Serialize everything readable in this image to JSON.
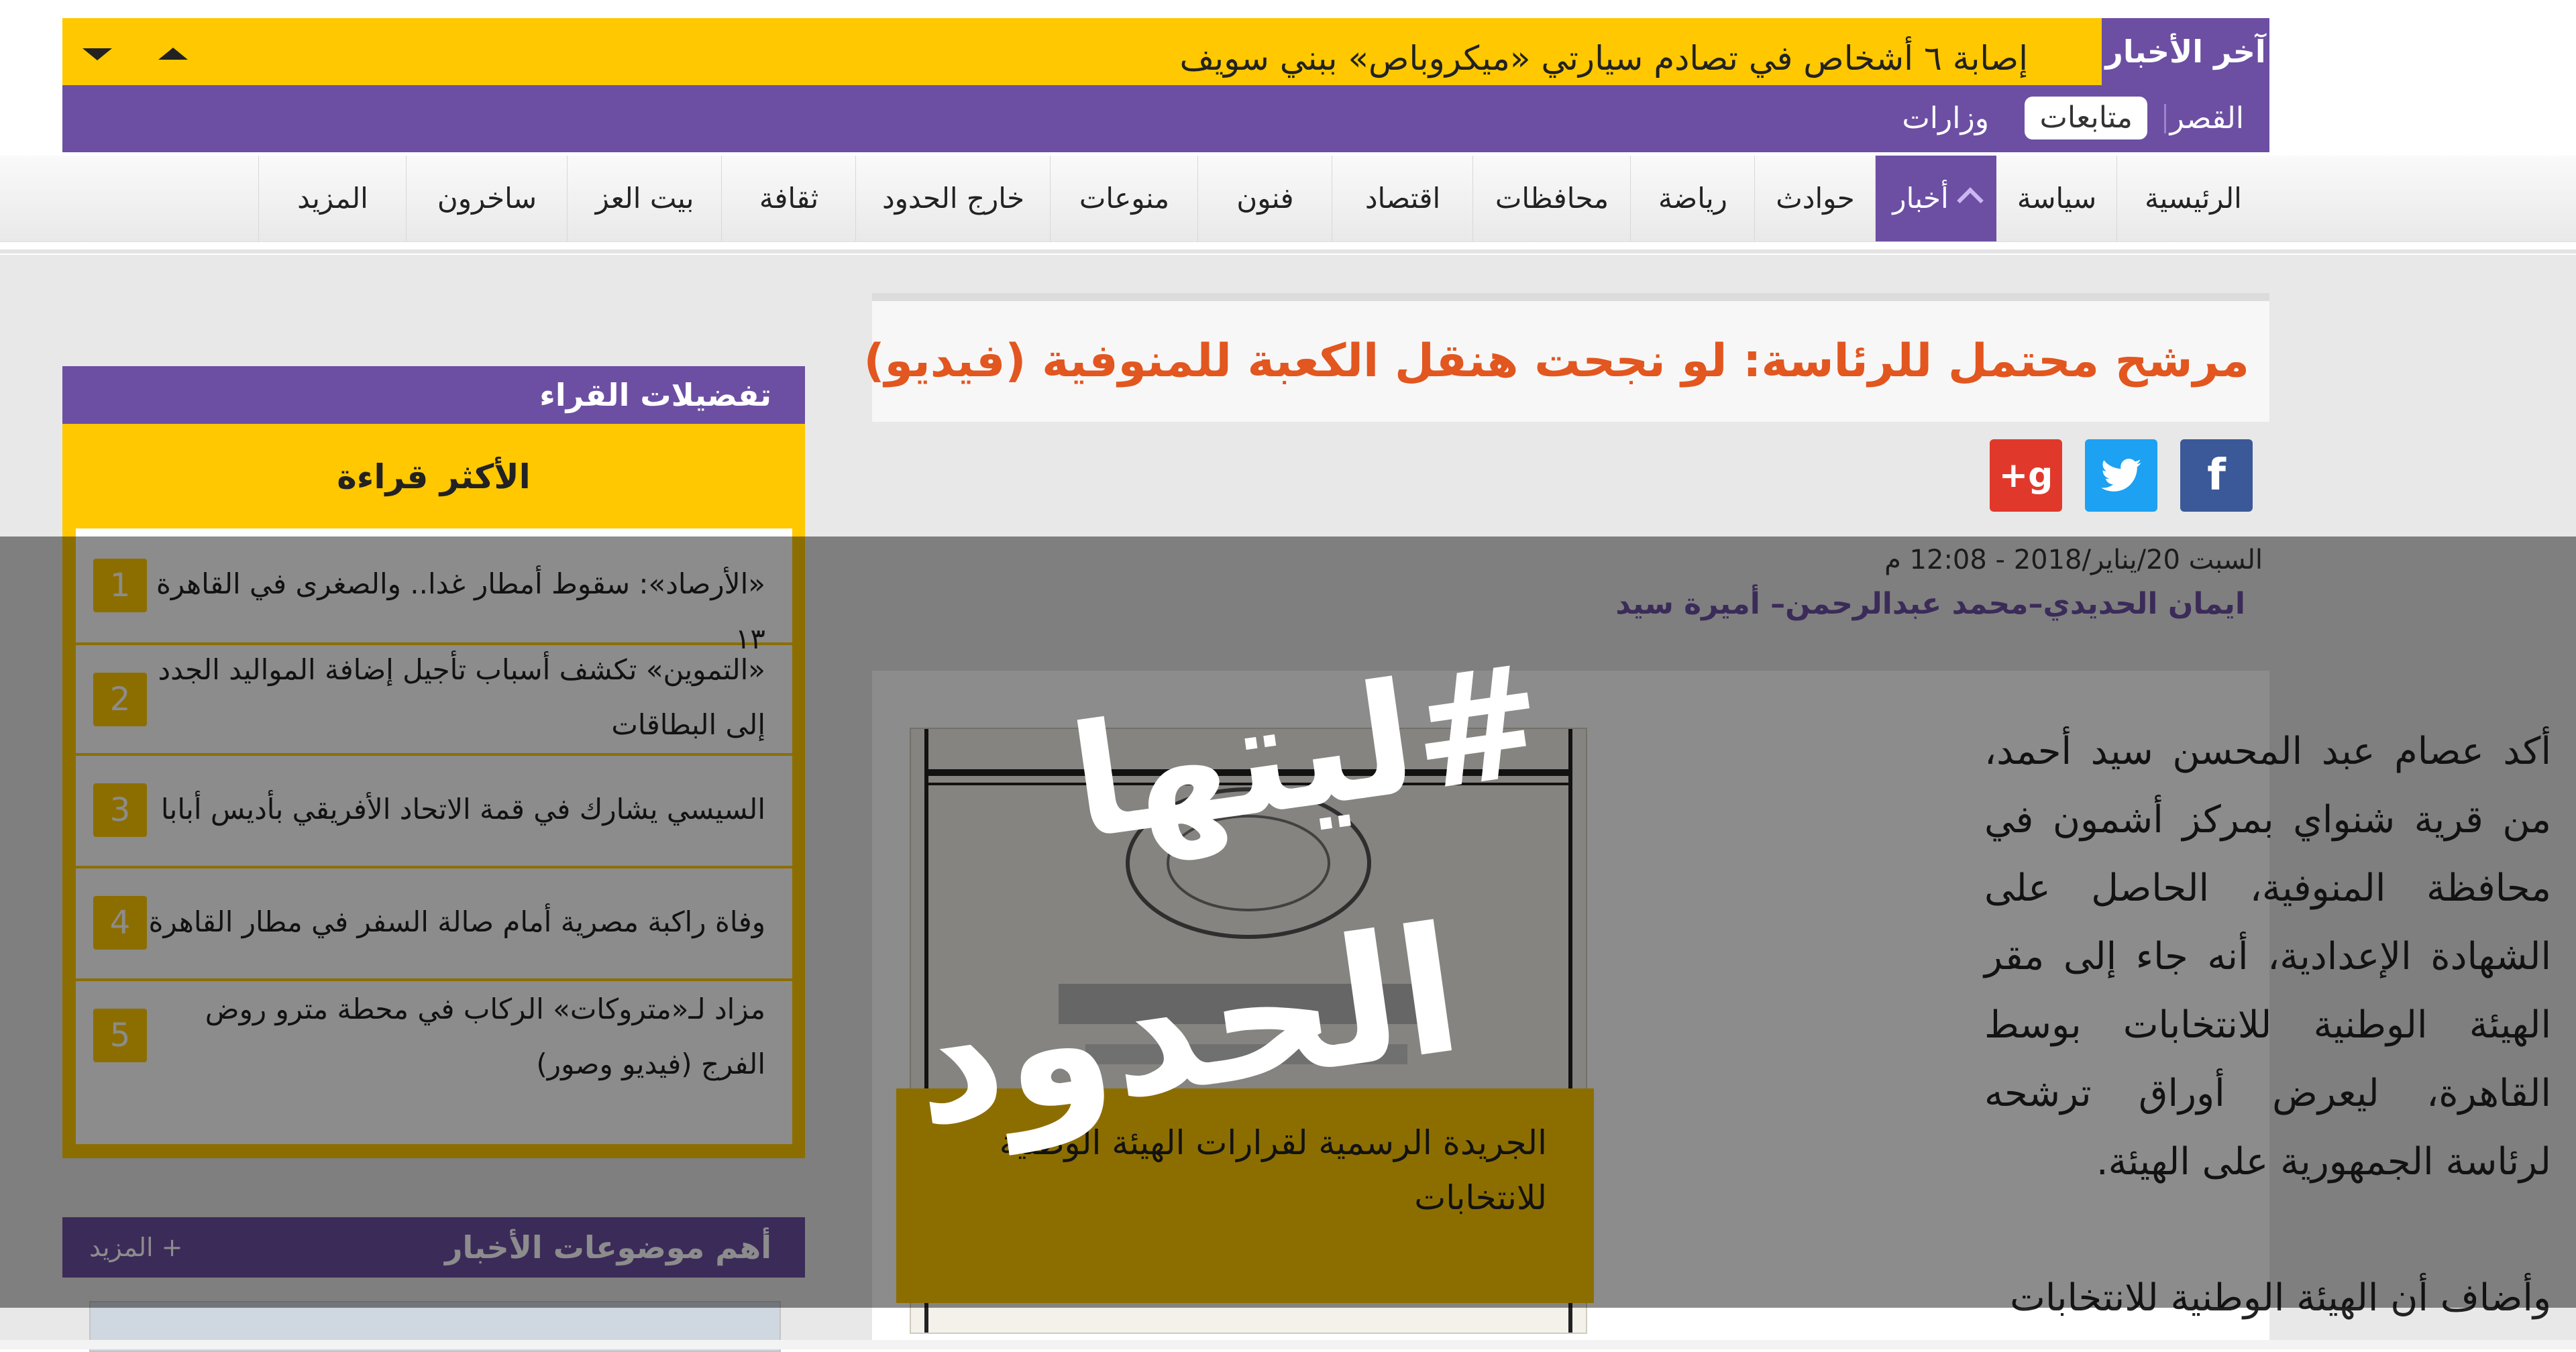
{
  "ticker": {
    "label": "آخر الأخبار",
    "headline": "إصابة ٦ أشخاص في تصادم سيارتي «ميكروباص» ببني سويف"
  },
  "subnav": {
    "items": [
      "القصر",
      "متابعات",
      "وزارات"
    ],
    "active_index": 1
  },
  "nav": {
    "items": [
      "الرئيسية",
      "سياسة",
      "أخبار",
      "حوادث",
      "رياضة",
      "محافظات",
      "اقتصاد",
      "فنون",
      "منوعات",
      "خارج الحدود",
      "ثقافة",
      "بيت العز",
      "ساخرون",
      "المزيد"
    ],
    "active": "أخبار"
  },
  "article": {
    "headline": "مرشح محتمل للرئاسة: لو نجحت هنقل الكعبة للمنوفية (فيديو)",
    "date": "السبت 20/يناير/2018 - 12:08 م",
    "authors": "ايمان الحديدي–محمد عبدالرحمن– أميرة سيد",
    "photo_caption": "الجريدة الرسمية لقرارات الهيئة الوطنية للانتخابات",
    "paragraph_1": "أكد عصام عبد المحسن سيد أحمد، من قرية شنواي بمركز أشمون في محافظة المنوفية، الحاصل على الشهادة الإعدادية، أنه جاء إلى مقر الهيئة الوطنية للانتخابات بوسط القاهرة، ليعرض أوراق ترشحه لرئاسة الجمهورية على الهيئة.",
    "paragraph_2": "وأضاف أن الهيئة الوطنية للانتخابات",
    "share": [
      "facebook-icon",
      "twitter-icon",
      "google-plus-icon"
    ]
  },
  "sidebar": {
    "header": "تفضيلات القراء",
    "panel_title": "الأكثر قراءة",
    "most_read": [
      {
        "num": "1",
        "title": "«الأرصاد»: سقوط أمطار غدا.. والصغرى في القاهرة ١٣"
      },
      {
        "num": "2",
        "title": "«التموين» تكشف أسباب تأجيل إضافة المواليد الجدد إلى البطاقات"
      },
      {
        "num": "3",
        "title": "السيسي يشارك في قمة الاتحاد الأفريقي بأديس أبابا"
      },
      {
        "num": "4",
        "title": "وفاة راكبة مصرية أمام صالة السفر في مطار القاهرة"
      },
      {
        "num": "5",
        "title": "مزاد لـ«متروكات» الركاب في محطة مترو روض الفرج (فيديو وصور)"
      }
    ],
    "topics_header": "أهم موضوعات الأخبار",
    "more_label": "+ المزيد"
  },
  "overlay": {
    "hashtag": "#ليتها",
    "word": "الحدود"
  },
  "colors": {
    "purple": "#6c4fa3",
    "yellow": "#ffc800",
    "headline_orange": "#e2561f",
    "facebook": "#3b5998",
    "twitter": "#1da1f2",
    "google_plus": "#e0392b"
  }
}
